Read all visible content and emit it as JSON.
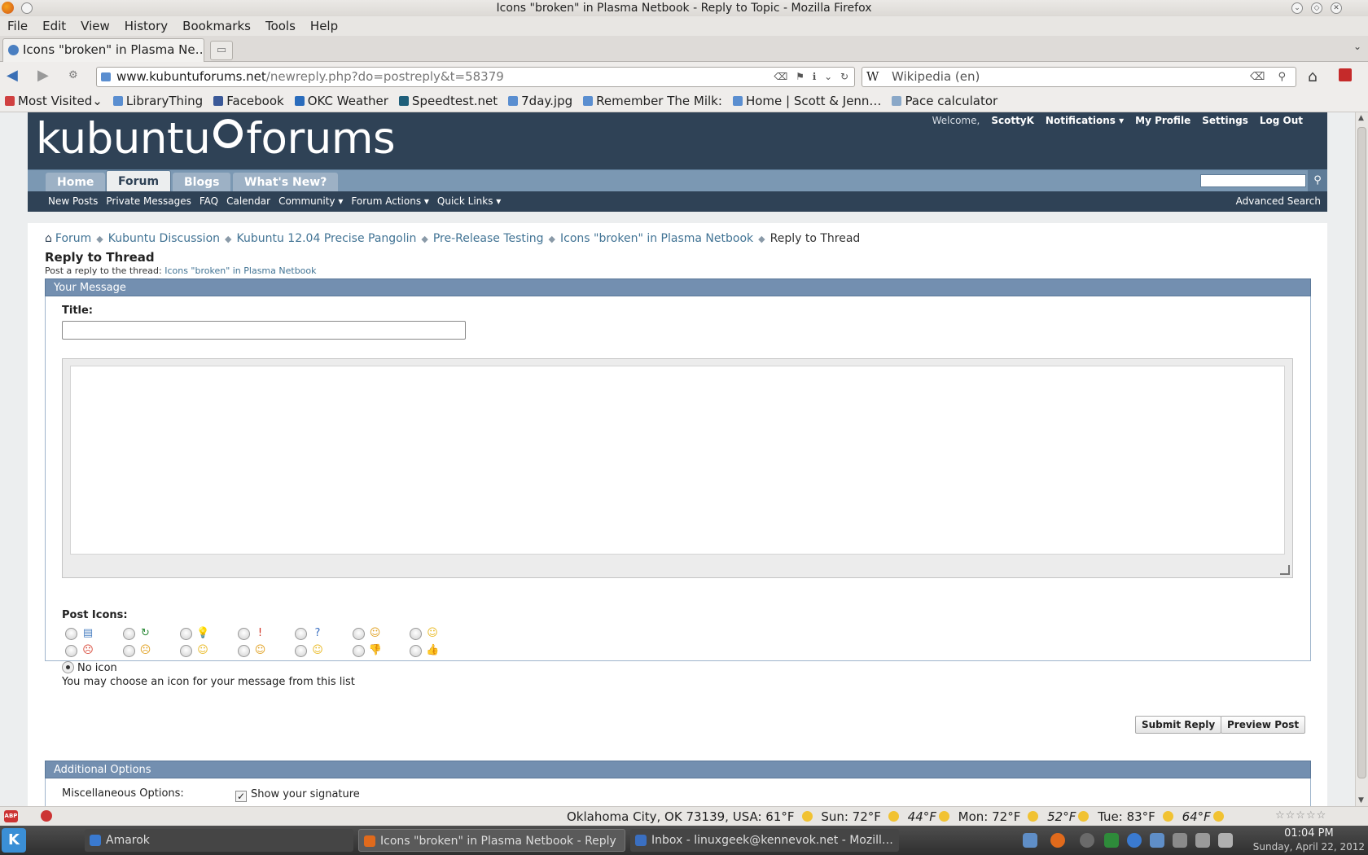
{
  "window": {
    "title": "Icons \"broken\" in Plasma Netbook - Reply to Topic - Mozilla Firefox"
  },
  "menubar": [
    "File",
    "Edit",
    "View",
    "History",
    "Bookmarks",
    "Tools",
    "Help"
  ],
  "tabs": [
    {
      "label": "Icons \"broken\" in Plasma Ne…",
      "active": true
    }
  ],
  "navbar": {
    "url_domain": "www.kubuntuforums.net",
    "url_path": "/newreply.php?do=postreply&t=58379",
    "search_engine": "W",
    "search_placeholder": "Wikipedia (en)"
  },
  "bookmarks": [
    {
      "label": "Most Visited⌄",
      "icon": "star-icon"
    },
    {
      "label": "LibraryThing",
      "icon": "globe-icon"
    },
    {
      "label": "Facebook",
      "icon": "facebook-icon"
    },
    {
      "label": "OKC Weather",
      "icon": "weather-icon"
    },
    {
      "label": "Speedtest.net",
      "icon": "speedtest-icon"
    },
    {
      "label": "7day.jpg",
      "icon": "globe-icon"
    },
    {
      "label": "Remember The Milk:",
      "icon": "globe-icon"
    },
    {
      "label": "Home | Scott & Jenn…",
      "icon": "globe-icon"
    },
    {
      "label": "Pace calculator",
      "icon": "pen-icon"
    }
  ],
  "site": {
    "logo_left": "kubuntu",
    "logo_right": "forums",
    "userbar": {
      "welcome": "Welcome,",
      "username": "ScottyK",
      "notifications": "Notifications ▾",
      "profile": "My Profile",
      "settings": "Settings",
      "logout": "Log Out"
    },
    "navtabs": [
      "Home",
      "Forum",
      "Blogs",
      "What's New?"
    ],
    "subnav": [
      "New Posts",
      "Private Messages",
      "FAQ",
      "Calendar",
      "Community ▾",
      "Forum Actions ▾",
      "Quick Links ▾"
    ],
    "advanced_search": "Advanced Search",
    "breadcrumb": [
      "Forum",
      "Kubuntu Discussion",
      "Kubuntu 12.04 Precise Pangolin",
      "Pre-Release Testing",
      "Icons \"broken\" in Plasma Netbook"
    ],
    "breadcrumb_current": "Reply to Thread"
  },
  "form": {
    "page_title": "Reply to Thread",
    "page_desc_prefix": "Post a reply to the thread:",
    "thread_link": "Icons \"broken\" in Plasma Netbook",
    "block_title": "Your Message",
    "title_label": "Title:",
    "title_value": "",
    "post_icons_label": "Post Icons:",
    "post_icons": [
      {
        "name": "post-icon-document",
        "glyph": "▤",
        "color": "#4a7fc1"
      },
      {
        "name": "post-icon-arrow",
        "glyph": "↻",
        "color": "#2e8b3a"
      },
      {
        "name": "post-icon-lightbulb",
        "glyph": "💡",
        "color": "#e0b020"
      },
      {
        "name": "post-icon-exclamation",
        "glyph": "!",
        "color": "#d03020"
      },
      {
        "name": "post-icon-question",
        "glyph": "?",
        "color": "#3a6fc1"
      },
      {
        "name": "post-icon-cool",
        "glyph": "☺",
        "color": "#e0a020"
      },
      {
        "name": "post-icon-wink",
        "glyph": "☺",
        "color": "#e8b820"
      },
      {
        "name": "post-icon-angry",
        "glyph": "☹",
        "color": "#d84a3a"
      },
      {
        "name": "post-icon-frown",
        "glyph": "☹",
        "color": "#e0a020"
      },
      {
        "name": "post-icon-embarrassed",
        "glyph": "☺",
        "color": "#e8b820"
      },
      {
        "name": "post-icon-smile",
        "glyph": "☺",
        "color": "#e0a020"
      },
      {
        "name": "post-icon-biggrin",
        "glyph": "☺",
        "color": "#e8b820"
      },
      {
        "name": "post-icon-thumbs-down",
        "glyph": "👎",
        "color": "#d84a3a"
      },
      {
        "name": "post-icon-thumbs-up",
        "glyph": "👍",
        "color": "#2e8b3a"
      }
    ],
    "no_icon_label": "No icon",
    "icon_hint": "You may choose an icon for your message from this list",
    "submit_label": "Submit Reply",
    "preview_label": "Preview Post",
    "additional_options": "Additional Options",
    "misc_label": "Miscellaneous Options:",
    "show_signature": "Show your signature"
  },
  "statusbar": {
    "weather": [
      "Oklahoma City, OK 73139, USA: 61°F",
      "Sun: 72°F",
      "44°F",
      "Mon: 72°F",
      "52°F",
      "Tue: 83°F",
      "64°F"
    ],
    "rating_stars": "☆☆☆☆☆"
  },
  "taskbar": {
    "kmenu": "K",
    "tasks": [
      {
        "label": "Amarok",
        "color": "#3a7ad0"
      },
      {
        "label": "Icons \"broken\" in Plasma Netbook - Reply",
        "color": "#e06a1c",
        "active": true
      },
      {
        "label": "Inbox - linuxgeek@kennevok.net - Mozill…",
        "color": "#3a6fc1"
      }
    ],
    "time": "01:04 PM",
    "date": "Sunday, April 22, 2012"
  },
  "colors": {
    "header_bg": "#2f4256",
    "navtab_bg": "#7b98b3",
    "block_head": "#738fb0",
    "link": "#417394"
  }
}
